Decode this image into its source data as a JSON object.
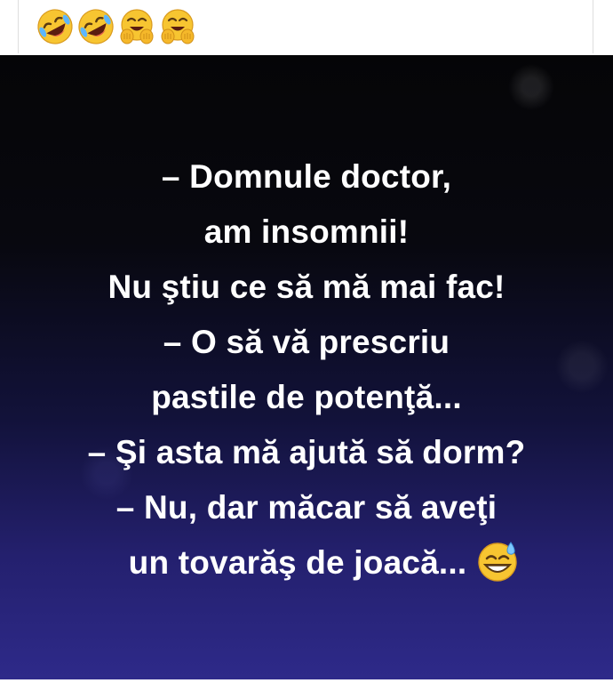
{
  "caption": {
    "emojis": [
      "rolling-on-floor-laughing",
      "rolling-on-floor-laughing",
      "smiling-face-with-open-hands",
      "smiling-face-with-open-hands"
    ]
  },
  "meme": {
    "lines": [
      "– Domnule doctor,",
      "am insomnii!",
      "Nu ştiu ce să mă mai fac!",
      "– O să vă prescriu",
      "pastile de potenţă...",
      "– Şi asta mă ajută să dorm?",
      "– Nu, dar măcar să aveţi",
      "un tovarăş de joacă..."
    ],
    "trailing_emoji": "grinning-face-with-sweat",
    "colors": {
      "text": "#ffffff",
      "background_top": "#050507",
      "background_bottom": "#2e2a8a"
    }
  }
}
